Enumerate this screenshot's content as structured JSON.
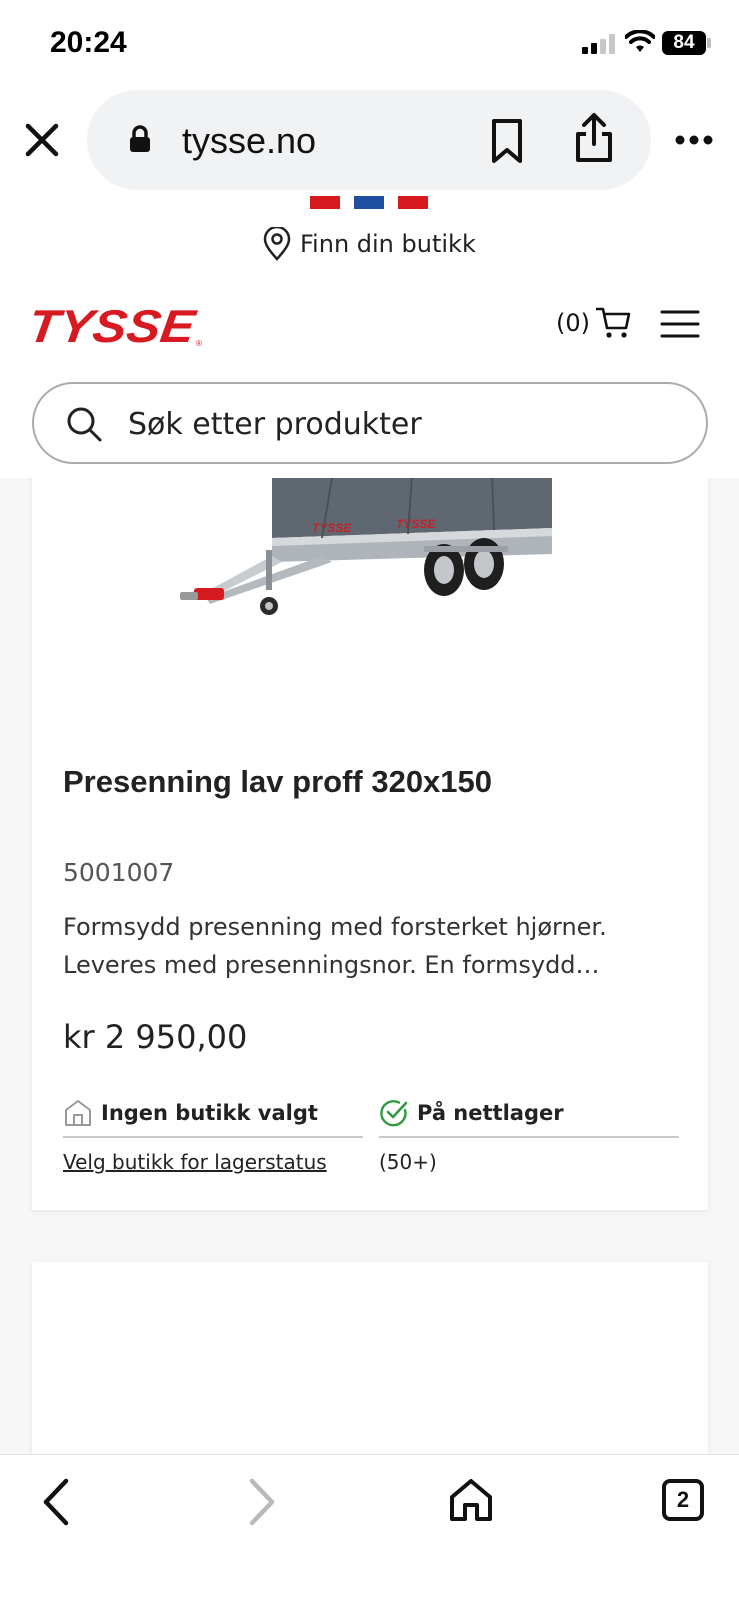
{
  "status_bar": {
    "time": "20:24",
    "battery": "84"
  },
  "browser": {
    "url": "tysse.no",
    "icons": [
      "close-icon",
      "lock-icon",
      "bookmark-icon",
      "share-icon",
      "more-icon"
    ]
  },
  "top_bar": {
    "store_finder_label": "Finn din butikk",
    "flag_colors": [
      "#d71920",
      "#1f4fa0",
      "#d71920"
    ]
  },
  "header": {
    "logo_text": "TYSSE",
    "cart_count": "(0)",
    "brand_color": "#d71920"
  },
  "search": {
    "placeholder": "Søk etter produkter"
  },
  "product": {
    "title": "Presenning lav proff 320x150",
    "sku": "5001007",
    "description": "Formsydd presenning med forsterket hjørner. Leveres med presenningsnor. En formsydd…",
    "price": "kr 2 950,00",
    "store_stock": {
      "heading": "Ingen butikk valgt",
      "link": "Velg butikk for lagerstatus"
    },
    "online_stock": {
      "heading": "På nettlager",
      "count": "(50+)",
      "status_color": "#2e9b3c"
    }
  },
  "toolbar": {
    "tabs_count": "2"
  }
}
